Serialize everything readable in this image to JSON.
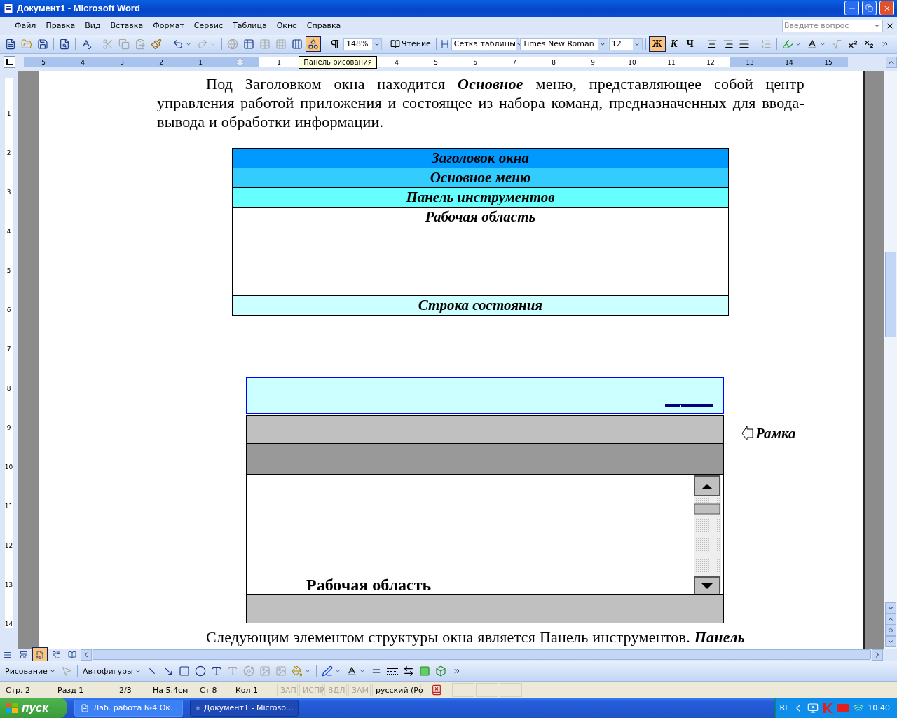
{
  "window": {
    "title": "Документ1 - Microsoft Word"
  },
  "menu": [
    "Файл",
    "Правка",
    "Вид",
    "Вставка",
    "Формат",
    "Сервис",
    "Таблица",
    "Окно",
    "Справка"
  ],
  "help_search": {
    "placeholder": "Введите вопрос"
  },
  "toolbar": {
    "drawing_toggle_on": true,
    "zoom": "148%",
    "reading": "Чтение",
    "style": "Сетка таблицы",
    "font": "Times New Roman",
    "size": "12",
    "bold_label": "Ж",
    "bold_on": true,
    "italic_label": "К",
    "underline_label": "Ч"
  },
  "ruler": [
    {
      "kind": "number",
      "label": "5",
      "margin": true
    },
    {
      "kind": "number",
      "label": "4",
      "margin": true
    },
    {
      "kind": "number",
      "label": "3",
      "margin": true
    },
    {
      "kind": "number",
      "label": "2",
      "margin": true
    },
    {
      "kind": "number",
      "label": "1",
      "margin": true
    },
    {
      "kind": "marker",
      "margin": true
    },
    {
      "kind": "number",
      "label": "1",
      "margin": false
    },
    {
      "kind": "tooltip",
      "label": "Панель рисования"
    },
    {
      "kind": "number",
      "label": "4",
      "margin": false
    },
    {
      "kind": "number",
      "label": "5",
      "margin": false
    },
    {
      "kind": "number",
      "label": "6",
      "margin": false
    },
    {
      "kind": "number",
      "label": "7",
      "margin": false
    },
    {
      "kind": "number",
      "label": "8",
      "margin": false
    },
    {
      "kind": "number",
      "label": "9",
      "margin": false
    },
    {
      "kind": "number",
      "label": "10",
      "margin": false
    },
    {
      "kind": "number",
      "label": "11",
      "margin": false
    },
    {
      "kind": "number",
      "label": "12",
      "margin": false
    },
    {
      "kind": "number",
      "label": "13",
      "margin": true
    },
    {
      "kind": "number",
      "label": "14",
      "margin": true
    },
    {
      "kind": "number",
      "label": "15",
      "margin": true
    }
  ],
  "vertical_ruler": [
    "1",
    "2",
    "3",
    "4",
    "5",
    "6",
    "7",
    "8",
    "9",
    "10",
    "11",
    "12",
    "13",
    "14"
  ],
  "doc": {
    "paragraph_1": "Под  Заголовком окна находится **Основное** меню, представляющее собой центр управления работой приложения и состоящее из набора команд, предназначенных для ввода-вывода и обработки информации.",
    "table": {
      "rows": [
        {
          "text": "Заголовок окна",
          "color": "#0099ff",
          "kind": "strip"
        },
        {
          "text": "Основное меню",
          "color": "#33ccff",
          "kind": "strip"
        },
        {
          "text": "Панель инструментов",
          "color": "#66ffff",
          "kind": "strip"
        },
        {
          "text": "Рабочая область",
          "color": "#ffffff",
          "kind": "area"
        },
        {
          "text": "Строка состояния",
          "color": "#ccffff",
          "kind": "strip"
        }
      ]
    },
    "diagram": {
      "work_area_label": "Рабочая область",
      "frame_label": "Рамка"
    },
    "paragraph_2": "Следующим элементом структуры окна является Панель инструментов. **Панель**"
  },
  "drawing_toolbar": {
    "drawing_menu": "Рисование",
    "autoshapes_menu": "Автофигуры"
  },
  "status": [
    {
      "text": "Стр. 2",
      "disabled": false
    },
    {
      "text": "Разд 1",
      "disabled": false
    },
    {
      "text": "2/3",
      "disabled": false
    },
    {
      "text": "На 5,4см",
      "disabled": false
    },
    {
      "text": "Ст 8",
      "disabled": false
    },
    {
      "text": "Кол 1",
      "disabled": false
    },
    {
      "text": "ЗАП",
      "disabled": true
    },
    {
      "text": "ИСПР",
      "disabled": true
    },
    {
      "text": "ВДЛ",
      "disabled": true
    },
    {
      "text": "ЗАМ",
      "disabled": true
    },
    {
      "text": "русский (Ро",
      "disabled": false
    }
  ],
  "taskbar": {
    "start": "пуск",
    "tasks": [
      {
        "title": "Лаб. работа №4 Ок…",
        "selected": false
      },
      {
        "title": "Документ1 - Microso…",
        "selected": true
      }
    ],
    "language": "RL",
    "clock": "10:40"
  }
}
